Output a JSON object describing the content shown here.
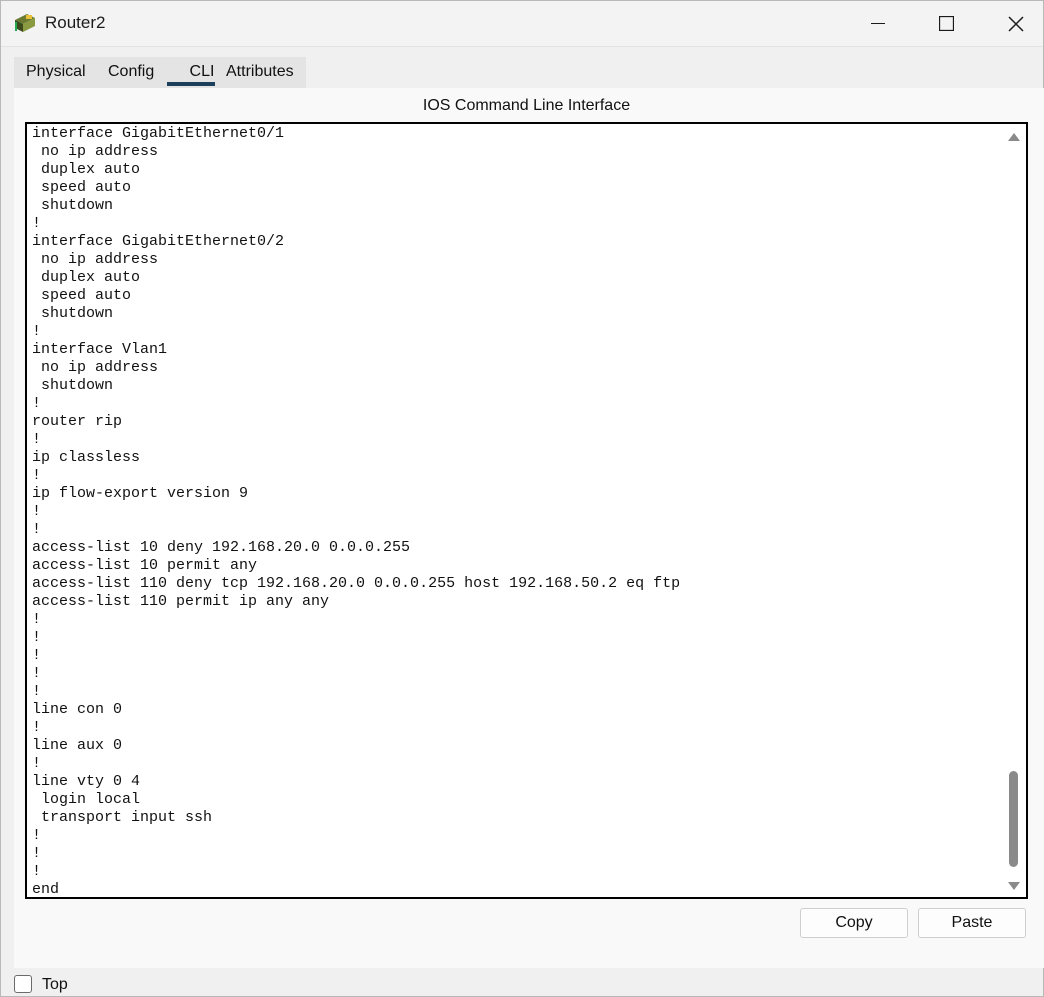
{
  "window": {
    "title": "Router2",
    "icon": "router-icon",
    "controls": [
      "minimize-icon",
      "maximize-icon",
      "close-icon"
    ]
  },
  "tabs": [
    {
      "label": "Physical",
      "active": false
    },
    {
      "label": "Config",
      "active": false
    },
    {
      "label": "CLI",
      "active": true
    },
    {
      "label": "Attributes",
      "active": false
    }
  ],
  "cli": {
    "title": "IOS Command Line Interface",
    "output": "interface GigabitEthernet0/1\n no ip address\n duplex auto\n speed auto\n shutdown\n!\ninterface GigabitEthernet0/2\n no ip address\n duplex auto\n speed auto\n shutdown\n!\ninterface Vlan1\n no ip address\n shutdown\n!\nrouter rip\n!\nip classless\n!\nip flow-export version 9\n!\n!\naccess-list 10 deny 192.168.20.0 0.0.0.255\naccess-list 10 permit any\naccess-list 110 deny tcp 192.168.20.0 0.0.0.255 host 192.168.50.2 eq ftp\naccess-list 110 permit ip any any\n!\n!\n!\n!\n!\nline con 0\n!\nline aux 0\n!\nline vty 0 4\n login local\n transport input ssh\n!\n!\n!\nend"
  },
  "buttons": {
    "copy": "Copy",
    "paste": "Paste"
  },
  "footer": {
    "top_label": "Top",
    "top_checked": false
  },
  "colors": {
    "accent": "#1c3f5c",
    "terminal_bg": "#ffffff",
    "window_bg": "#f0f0f0"
  }
}
